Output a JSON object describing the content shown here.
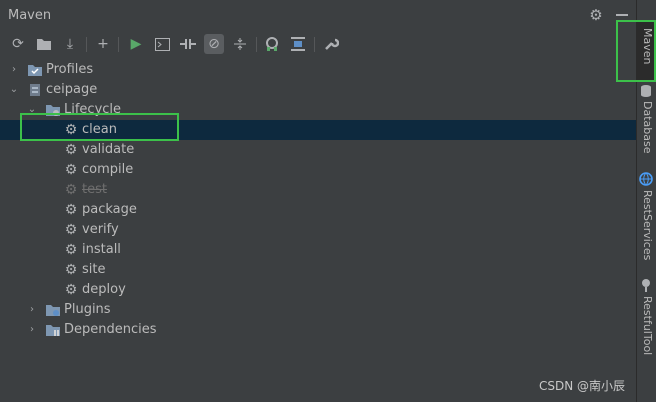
{
  "window": {
    "title": "Maven"
  },
  "toolbar": {
    "icons": [
      "reload-icon",
      "generate-sources-icon",
      "download-icon",
      "add-icon",
      "run-icon",
      "execute-goal-icon",
      "toggle-offline-icon",
      "skip-tests-icon",
      "collapse-icon",
      "show-dependencies-icon",
      "collapse-all-icon",
      "settings-icon"
    ]
  },
  "tree": {
    "profiles": "Profiles",
    "project": "ceipage",
    "lifecycle": "Lifecycle",
    "goals": [
      "clean",
      "validate",
      "compile",
      "test",
      "package",
      "verify",
      "install",
      "site",
      "deploy"
    ],
    "plugins": "Plugins",
    "dependencies": "Dependencies"
  },
  "sidebar": {
    "tabs": [
      "Maven",
      "Database",
      "RestServices",
      "RestfulTool"
    ]
  },
  "watermark": "CSDN @南小辰",
  "colors": {
    "selection": "#0d293e",
    "highlight_box": "#3cc14a",
    "run_green": "#59a869"
  }
}
